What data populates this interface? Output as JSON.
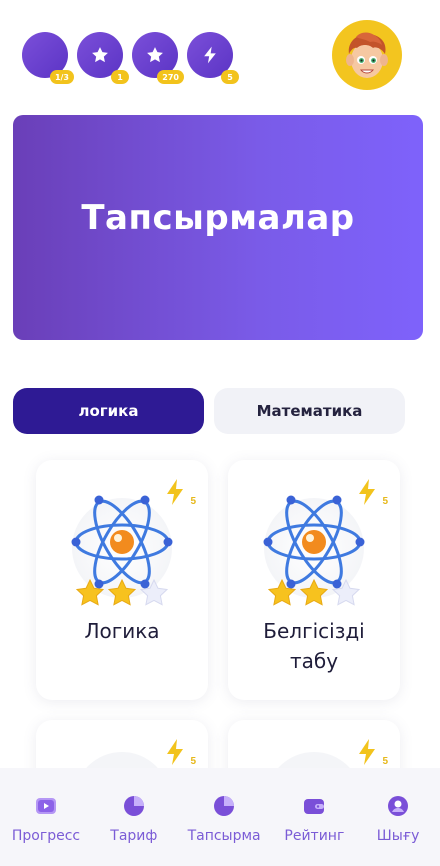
{
  "status": [
    {
      "icon": "progress-circle-icon",
      "badge": "1/3"
    },
    {
      "icon": "star-icon",
      "badge": "1"
    },
    {
      "icon": "star-icon",
      "badge": "270"
    },
    {
      "icon": "lightning-icon",
      "badge": "5"
    }
  ],
  "hero": {
    "title": "Тапсырмалар"
  },
  "tabs": [
    {
      "label": "логика",
      "active": true
    },
    {
      "label": "Математика",
      "active": false
    }
  ],
  "cards": [
    {
      "title": "Логика",
      "energy": "5",
      "stars_filled": 2,
      "stars_total": 3,
      "icon": "atom-icon"
    },
    {
      "title": "Белгісізді табу",
      "energy": "5",
      "stars_filled": 2,
      "stars_total": 3,
      "icon": "atom-icon"
    },
    {
      "title": "",
      "energy": "5"
    },
    {
      "title": "",
      "energy": "5"
    }
  ],
  "nav": [
    {
      "label": "Прогресс",
      "icon": "video-play-icon"
    },
    {
      "label": "Тариф",
      "icon": "pie-chart-icon"
    },
    {
      "label": "Тапсырма",
      "icon": "pie-chart-icon"
    },
    {
      "label": "Рейтинг",
      "icon": "wallet-icon"
    },
    {
      "label": "Шығу",
      "icon": "user-icon"
    }
  ],
  "colors": {
    "accent": "#2e1a94",
    "hero_start": "#6a3fb8",
    "hero_end": "#7e62fb",
    "badge": "#f2c31c",
    "nav_label": "#7b5cd6"
  }
}
